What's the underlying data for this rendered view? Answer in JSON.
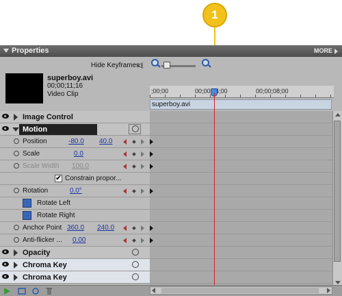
{
  "callout": {
    "number": "1",
    "color": "#f2c21b"
  },
  "panel": {
    "title": "Properties",
    "more_label": "MORE"
  },
  "header": {
    "hide_keyframes": "Hide Keyframes",
    "hide_keyframes_icon": "◁|",
    "clip_name": "superboy.avi",
    "clip_duration": "00;00;11;16",
    "clip_type": "Video Clip"
  },
  "timeline": {
    "ruler_ticks": [
      ";00;00",
      "00;00;04;00",
      "00;00;08;00"
    ],
    "clip_label": "superboy.avi",
    "playhead_color": "#d21f1f"
  },
  "rows": {
    "image_control": "Image Control",
    "motion": "Motion",
    "position_label": "Position",
    "position_x": "-80.0",
    "position_y": "40.0",
    "scale_label": "Scale",
    "scale_value": "0.0",
    "scale_width_label": "Scale Width",
    "scale_width_value": "100.0",
    "constrain_label": "Constrain propor...",
    "rotation_label": "Rotation",
    "rotation_value": "0.0°",
    "rotate_left": "Rotate Left",
    "rotate_right": "Rotate Right",
    "anchor_label": "Anchor Point",
    "anchor_x": "360.0",
    "anchor_y": "240.0",
    "antiflicker_label": "Anti-flicker ...",
    "antiflicker_value": "0.00",
    "opacity": "Opacity",
    "chroma_key_1": "Chroma Key",
    "chroma_key_2": "Chroma Key"
  },
  "icons": [
    "eye-icon",
    "expand-triangle-icon",
    "reset-icon",
    "stopwatch-icon",
    "zoom-in-icon",
    "zoom-out-icon",
    "play-icon",
    "trash-icon"
  ]
}
